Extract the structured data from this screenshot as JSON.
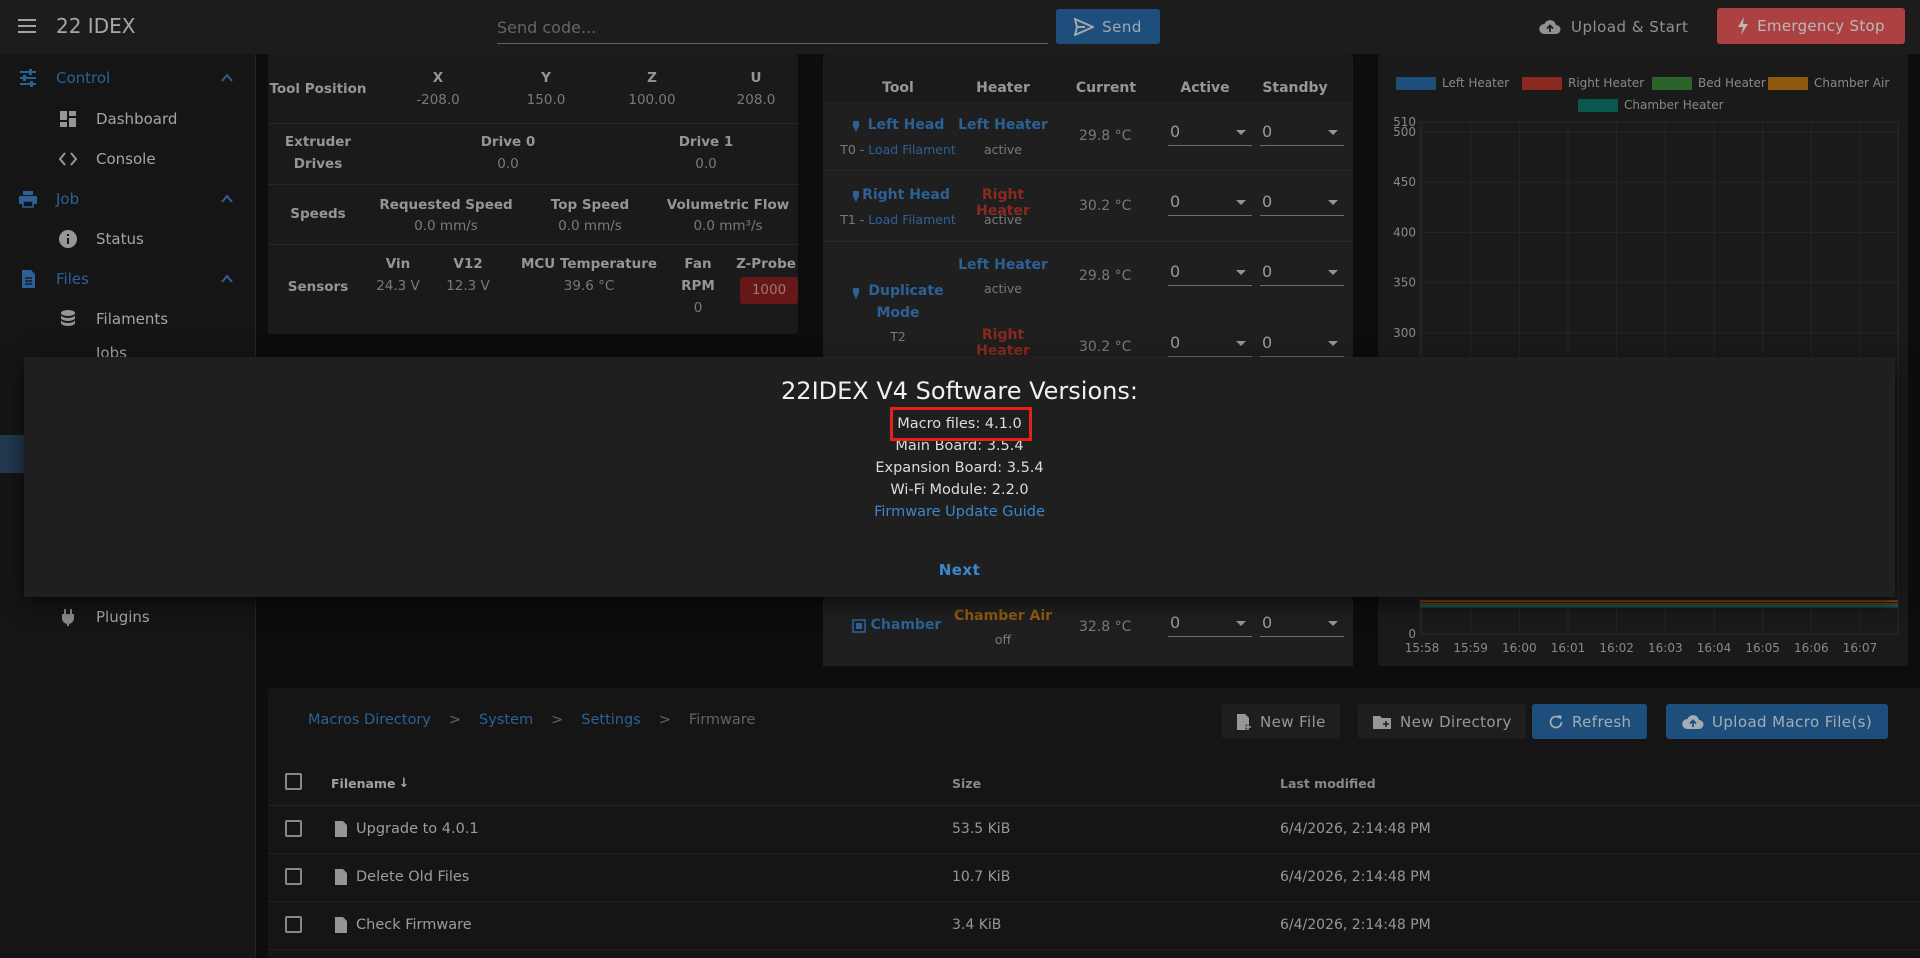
{
  "header": {
    "title": "22 IDEX",
    "code_placeholder": "Send code...",
    "send_label": "Send",
    "upload_start_label": "Upload & Start",
    "emergency_label": "Emergency Stop"
  },
  "sidebar": {
    "groups": [
      {
        "label": "Control",
        "items": [
          "Dashboard",
          "Console"
        ]
      },
      {
        "label": "Job",
        "items": [
          "Status"
        ]
      },
      {
        "label": "Files",
        "items": [
          "Filaments"
        ]
      }
    ],
    "partial_item": "Jobs",
    "bottom_item": "Plugins"
  },
  "status": {
    "tool_position_label": "Tool Position",
    "axes": [
      {
        "name": "X",
        "value": "-208.0"
      },
      {
        "name": "Y",
        "value": "150.0"
      },
      {
        "name": "Z",
        "value": "100.00"
      },
      {
        "name": "U",
        "value": "208.0"
      }
    ],
    "extruder_label_1": "Extruder",
    "extruder_label_2": "Drives",
    "drives": [
      {
        "name": "Drive 0",
        "value": "0.0"
      },
      {
        "name": "Drive 1",
        "value": "0.0"
      }
    ],
    "speeds_label": "Speeds",
    "speeds": [
      {
        "name": "Requested Speed",
        "value": "0.0 mm/s"
      },
      {
        "name": "Top Speed",
        "value": "0.0 mm/s"
      },
      {
        "name": "Volumetric Flow",
        "value": "0.0 mm³/s"
      }
    ],
    "sensors_label": "Sensors",
    "sensors": [
      {
        "name": "Vin",
        "value": "24.3 V"
      },
      {
        "name": "V12",
        "value": "12.3 V"
      },
      {
        "name": "MCU Temperature",
        "value": "39.6 °C"
      }
    ],
    "fan_label_1": "Fan",
    "fan_label_2": "RPM",
    "fan_value": "0",
    "zprobe_label": "Z-Probe",
    "zprobe_value": "1000"
  },
  "tools": {
    "headers": [
      "Tool",
      "Heater",
      "Current",
      "Active",
      "Standby"
    ],
    "rows": [
      {
        "tool": "Left Head",
        "sub_prefix": "T0 - ",
        "sub_link": "Load Filament",
        "heater": "Left Heater",
        "heater_color": "#3c87cf",
        "state": "active",
        "current": "29.8 °C",
        "active": "0",
        "standby": "0"
      },
      {
        "tool": "Right Head",
        "sub_prefix": "T1 - ",
        "sub_link": "Load Filament",
        "heater": "Right Heater",
        "heater_color": "#c0392b",
        "state": "active",
        "current": "30.2 °C",
        "active": "0",
        "standby": "0"
      }
    ],
    "dup_tool_1": "Duplicate",
    "dup_tool_2": "Mode",
    "dup_sub": "T2",
    "dup_heater_1": "Left Heater",
    "dup_state_1": "active",
    "dup_current_1": "29.8 °C",
    "dup_heater_2": "Right Heater",
    "dup_current_2": "30.2 °C",
    "dup_active": "0",
    "dup_standby": "0",
    "chamber_tool": "Chamber",
    "chamber_heater": "Chamber Air",
    "chamber_state": "off",
    "chamber_current": "32.8 °C",
    "chamber_active": "0",
    "chamber_standby": "0"
  },
  "chart_data": {
    "type": "line",
    "legend": [
      {
        "name": "Left Heater",
        "color": "#2a6cac"
      },
      {
        "name": "Right Heater",
        "color": "#c0392b"
      },
      {
        "name": "Bed Heater",
        "color": "#3b8a3b"
      },
      {
        "name": "Chamber Air",
        "color": "#c77d12"
      },
      {
        "name": "Chamber Heater",
        "color": "#0f7a6e"
      }
    ],
    "y_ticks_top": [
      "510",
      "500",
      "450",
      "400",
      "350",
      "300"
    ],
    "y_tick_bottom": "0",
    "x_ticks": [
      "15:58",
      "15:59",
      "16:00",
      "16:01",
      "16:02",
      "16:03",
      "16:04",
      "16:05",
      "16:06",
      "16:07"
    ],
    "ylim": [
      0,
      510
    ]
  },
  "files": {
    "breadcrumb": [
      "Macros Directory",
      "System",
      "Settings"
    ],
    "breadcrumb_current": "Firmware",
    "sep": ">",
    "new_file": "New File",
    "new_directory": "New Directory",
    "refresh": "Refresh",
    "upload_macro": "Upload Macro File(s)",
    "columns": {
      "filename": "Filename",
      "size": "Size",
      "modified": "Last modified"
    },
    "rows": [
      {
        "name": "Upgrade to 4.0.1",
        "size": "53.5 KiB",
        "modified": "6/4/2026, 2:14:48 PM"
      },
      {
        "name": "Delete Old Files",
        "size": "10.7 KiB",
        "modified": "6/4/2026, 2:14:48 PM"
      },
      {
        "name": "Check Firmware",
        "size": "3.4 KiB",
        "modified": "6/4/2026, 2:14:48 PM"
      }
    ]
  },
  "dialog": {
    "title": "22IDEX V4 Software Versions:",
    "lines": [
      "Macro files: 4.1.0",
      "Main Board: 3.5.4",
      "Expansion Board: 3.5.4",
      "Wi-Fi Module: 2.2.0"
    ],
    "link": "Firmware Update Guide",
    "next": "Next"
  }
}
